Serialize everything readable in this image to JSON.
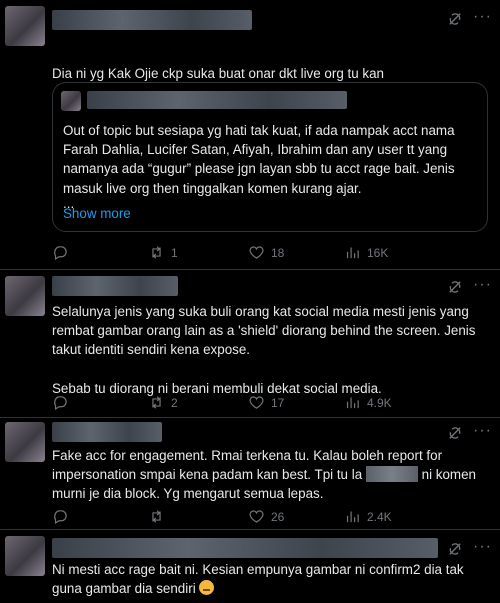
{
  "posts": [
    {
      "text": "Dia ni yg Kak Ojie ckp suka buat onar dkt live org tu kan",
      "quote": {
        "text": "Out of topic but sesiapa yg hati tak kuat, if ada nampak acct nama Farah Dahlia, Lucifer Satan, Afiyah, Ibrahim dan any user tt yang namanya ada “gugur” please jgn layan sbb tu acct rage bait. Jenis masuk live org then tinggalkan komen kurang ajar.",
        "ellipsis": "...",
        "show_more": "Show more"
      },
      "stats": {
        "replies": "",
        "reposts": "1",
        "likes": "18",
        "views": "16K"
      }
    },
    {
      "text": "Selalunya jenis yang suka buli orang kat social media mesti jenis yang rembat gambar orang lain as a 'shield' diorang behind the screen. Jenis takut identiti sendiri kena expose.\n\nSebab tu diorang ni berani membuli dekat social media.",
      "stats": {
        "replies": "",
        "reposts": "2",
        "likes": "17",
        "views": "4.9K"
      }
    },
    {
      "text_before": "Fake acc for engagement. Rmai terkena tu. Kalau boleh report for impersonation smpai kena padam kan best. Tpi tu la",
      "text_after": "ni komen murni je dia block. Yg mengarut semua lepas.",
      "stats": {
        "replies": "",
        "reposts": "",
        "likes": "26",
        "views": "2.4K"
      }
    },
    {
      "text": "Ni mesti acc rage bait ni. Kesian empunya gambar ni confirm2 dia tak guna gambar dia sendiri",
      "emoji": "grimacing-face-emoji"
    }
  ],
  "more_label": "···",
  "colors": {
    "background": "#000000",
    "text": "#e7e9ea",
    "muted": "#71767b",
    "link": "#1d9bf0",
    "border": "#2f3336"
  }
}
